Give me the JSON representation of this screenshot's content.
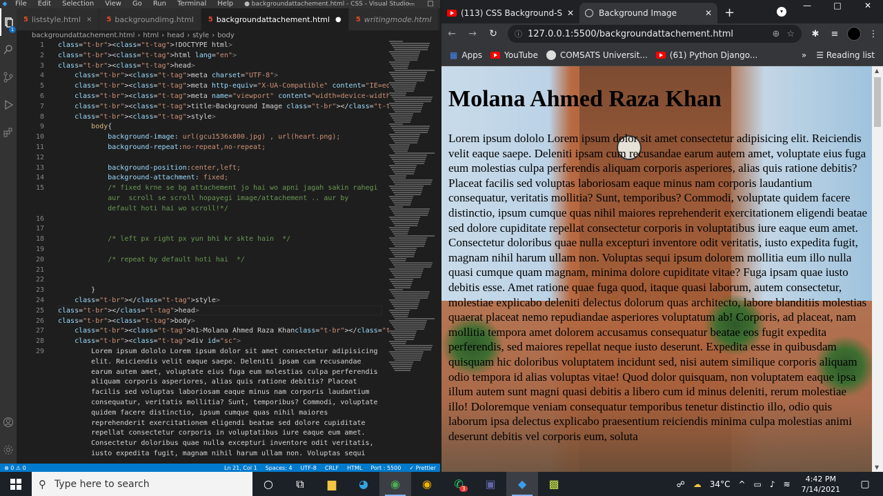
{
  "vscode": {
    "window_title": "● backgroundattachement.html - CSS - Visual Studio...",
    "menu": [
      "File",
      "Edit",
      "Selection",
      "View",
      "Go",
      "Run",
      "Terminal",
      "Help"
    ],
    "tabs": [
      {
        "label": "liststyle.html",
        "active": false,
        "italic": false,
        "marker": "×"
      },
      {
        "label": "backgroundimg.html",
        "active": false,
        "italic": false,
        "marker": ""
      },
      {
        "label": "backgroundattachement.html",
        "active": true,
        "italic": false,
        "marker": "●"
      },
      {
        "label": "writingmode.html",
        "active": false,
        "italic": true,
        "marker": ""
      }
    ],
    "badge": "1",
    "breadcrumb": [
      "backgroundattachement.html",
      "html",
      "head",
      "style",
      "body"
    ],
    "lines": [
      {
        "n": "1",
        "text": "<!DOCTYPE html>"
      },
      {
        "n": "2",
        "text": "<html lang=\"en\">"
      },
      {
        "n": "3",
        "text": "<head>"
      },
      {
        "n": "4",
        "text": "    <meta charset=\"UTF-8\">"
      },
      {
        "n": "5",
        "text": "    <meta http-equiv=\"X-UA-Compatible\" content=\"IE=edge\">"
      },
      {
        "n": "6",
        "text": "    <meta name=\"viewport\" content=\"width=device-width, initial-scale=1.0\">"
      },
      {
        "n": "7",
        "text": "    <title>Background Image </title>"
      },
      {
        "n": "8",
        "text": "    <style>"
      },
      {
        "n": "9",
        "text": "        body{"
      },
      {
        "n": "10",
        "text": "            background-image: url(gcu1536x800.jpg) , url(heart.png);"
      },
      {
        "n": "11",
        "text": "            background-repeat:no-repeat,no-repeat;"
      },
      {
        "n": "12",
        "text": ""
      },
      {
        "n": "13",
        "text": "            background-position:center,left;"
      },
      {
        "n": "14",
        "text": "            background-attachment: fixed;"
      },
      {
        "n": "15",
        "text": "            /* fixed krne se bg attachement jo hai wo apni jagah sakin rahegi"
      },
      {
        "n": "",
        "text": "            aur  scroll se scroll hopayegi image/attachement .. aur by"
      },
      {
        "n": "",
        "text": "            default hoti hai wo scroll!*/"
      },
      {
        "n": "16",
        "text": ""
      },
      {
        "n": "17",
        "text": ""
      },
      {
        "n": "18",
        "text": "            /* left px right px yun bhi kr skte hain  */"
      },
      {
        "n": "19",
        "text": ""
      },
      {
        "n": "20",
        "text": "            /* repeat by default hoti hai  */"
      },
      {
        "n": "21",
        "text": ""
      },
      {
        "n": "22",
        "text": ""
      },
      {
        "n": "23",
        "text": "        }"
      },
      {
        "n": "24",
        "text": "    </style>"
      },
      {
        "n": "25",
        "text": "</head>"
      },
      {
        "n": "26",
        "text": "<body>"
      },
      {
        "n": "27",
        "text": "    <h1>Molana Ahmed Raza Khan</h1>"
      },
      {
        "n": "28",
        "text": "    <div id=\"sc\">"
      },
      {
        "n": "29",
        "text": "        Lorem ipsum dololo Lorem ipsum dolor sit amet consectetur adipisicing"
      },
      {
        "n": "",
        "text": "        elit. Reiciendis velit eaque saepe. Deleniti ipsam cum recusandae"
      },
      {
        "n": "",
        "text": "        earum autem amet, voluptate eius fuga eum molestias culpa perferendis"
      },
      {
        "n": "",
        "text": "        aliquam corporis asperiores, alias quis ratione debitis? Placeat"
      },
      {
        "n": "",
        "text": "        facilis sed voluptas laboriosam eaque minus nam corporis laudantium"
      },
      {
        "n": "",
        "text": "        consequatur, veritatis mollitia? Sunt, temporibus? Commodi, voluptate"
      },
      {
        "n": "",
        "text": "        quidem facere distinctio, ipsum cumque quas nihil maiores"
      },
      {
        "n": "",
        "text": "        reprehenderit exercitationem eligendi beatae sed dolore cupiditate"
      },
      {
        "n": "",
        "text": "        repellat consectetur corporis in voluptatibus iure eaque eum amet."
      },
      {
        "n": "",
        "text": "        Consectetur doloribus quae nulla excepturi inventore odit veritatis,"
      },
      {
        "n": "",
        "text": "        iusto expedita fugit, magnam nihil harum ullam non. Voluptas sequi"
      }
    ],
    "status": [
      "⊗ 0 ⚠ 0",
      "Ln 21, Col 1",
      "Spaces: 4",
      "UTF-8",
      "CRLF",
      "HTML",
      "Port : 5500",
      "✓ Prettier"
    ]
  },
  "chrome": {
    "tabs": [
      {
        "label": "(113) CSS Background-Size",
        "active": false,
        "icon": "youtube"
      },
      {
        "label": "Background Image",
        "active": true,
        "icon": "globe"
      }
    ],
    "url": "127.0.0.1:5500/backgroundattachement.html",
    "bookmarks": [
      {
        "label": "Apps",
        "icon": "apps"
      },
      {
        "label": "YouTube",
        "icon": "youtube"
      },
      {
        "label": "COMSATS Universit...",
        "icon": "comsats"
      },
      {
        "label": "(61) Python Django...",
        "icon": "youtube"
      }
    ],
    "reading_list": "Reading list",
    "more": "»",
    "page": {
      "heading": "Molana Ahmed Raza Khan",
      "paragraph": "Lorem ipsum dololo Lorem ipsum dolor sit amet consectetur adipisicing elit. Reiciendis velit eaque saepe. Deleniti ipsam cum recusandae earum autem amet, voluptate eius fuga eum molestias culpa perferendis aliquam corporis asperiores, alias quis ratione debitis? Placeat facilis sed voluptas laboriosam eaque minus nam corporis laudantium consequatur, veritatis mollitia? Sunt, temporibus? Commodi, voluptate quidem facere distinctio, ipsum cumque quas nihil maiores reprehenderit exercitationem eligendi beatae sed dolore cupiditate repellat consectetur corporis in voluptatibus iure eaque eum amet. Consectetur doloribus quae nulla excepturi inventore odit veritatis, iusto expedita fugit, magnam nihil harum ullam non. Voluptas sequi ipsum dolorem mollitia eum illo nulla quasi cumque quam magnam, minima dolore cupiditate vitae? Fuga ipsam quae iusto debitis esse. Amet ratione quae fuga quod, itaque quasi laborum, autem consectetur, molestiae explicabo deleniti delectus dolorum quas architecto, labore blanditiis molestias quaerat placeat nemo repudiandae asperiores voluptatum ab! Corporis, ad placeat, nam mollitia tempora amet dolorem accusamus consequatur beatae eos fugit expedita perferendis, sed maiores repellat neque iusto deserunt. Expedita esse in quibusdam quisquam hic doloribus voluptatem incidunt sed, nisi autem similique corporis aliquam odio tempora id alias voluptas vitae! Quod dolor quisquam, non voluptatem eaque ipsa illum autem sunt magni quasi debitis a libero cum id minus deleniti, rerum molestiae illo! Doloremque veniam consequatur temporibus tenetur distinctio illo, odio quis laborum ipsa delectus explicabo praesentium reiciendis minima culpa molestias animi deserunt debitis vel corporis eum, soluta"
    }
  },
  "taskbar": {
    "search_placeholder": "Type here to search",
    "weather": "34°C",
    "time": "4:42 PM",
    "date": "7/14/2021",
    "whatsapp_badge": "3"
  }
}
